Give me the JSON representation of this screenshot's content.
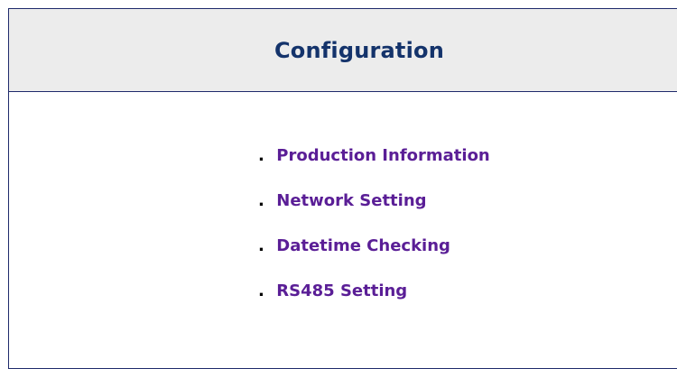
{
  "header": {
    "title": "Configuration"
  },
  "menu": {
    "bullet": ".",
    "items": [
      {
        "label": "Production Information"
      },
      {
        "label": "Network Setting"
      },
      {
        "label": "Datetime Checking"
      },
      {
        "label": "RS485 Setting"
      }
    ]
  },
  "colors": {
    "title": "#14336b",
    "link": "#5a1e96",
    "header_bg": "#ececec",
    "border": "#1f2a6b"
  }
}
